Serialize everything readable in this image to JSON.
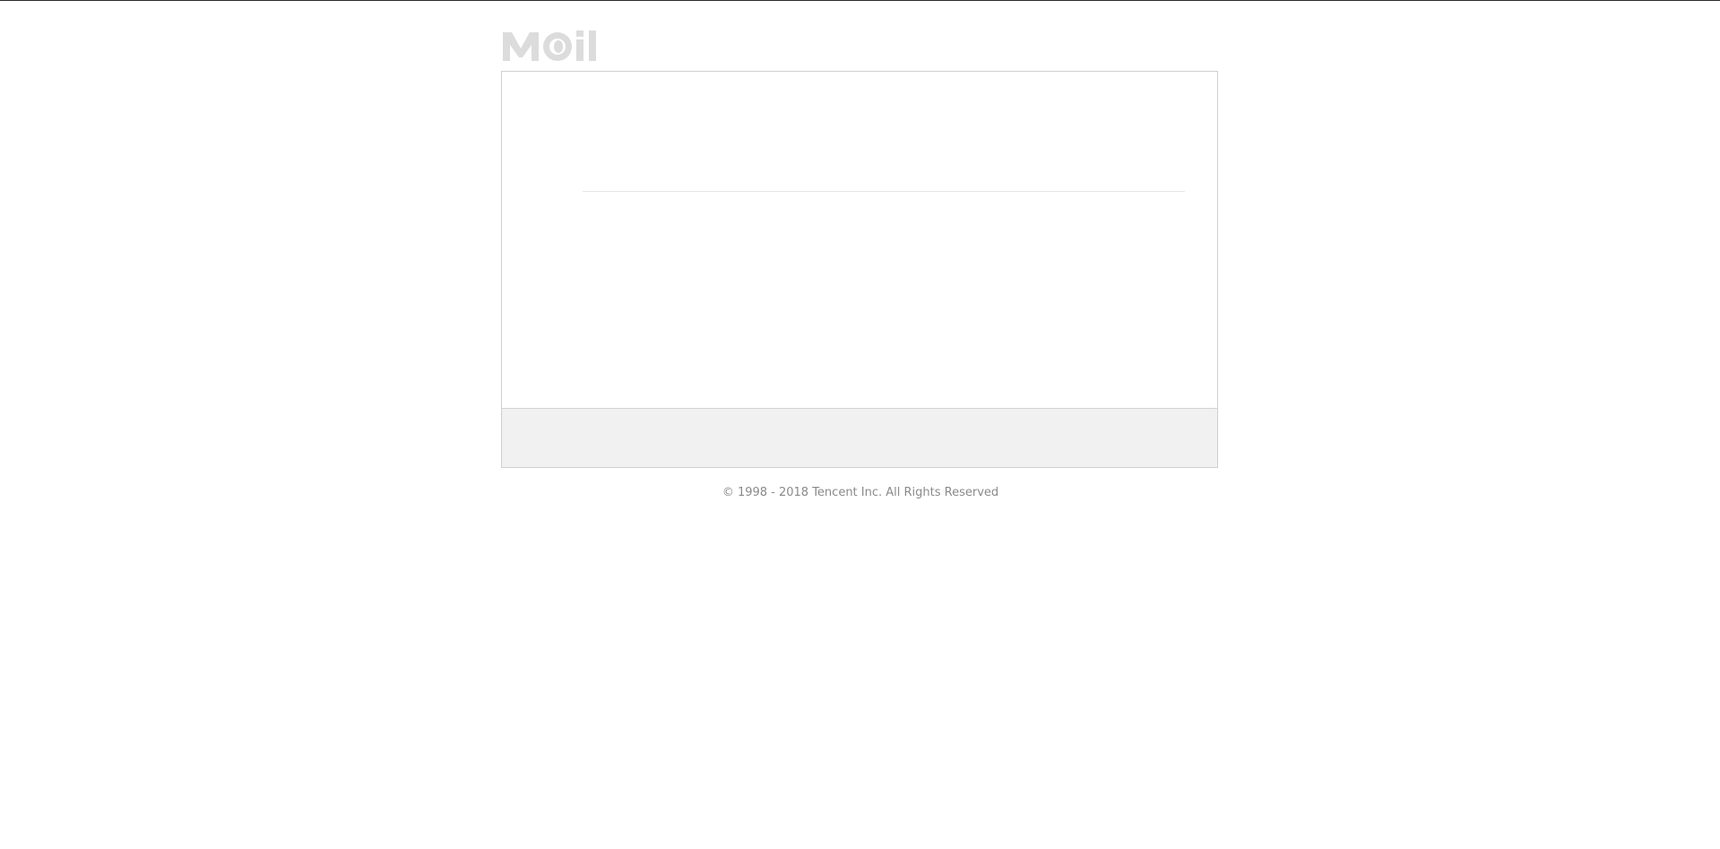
{
  "logo": {
    "text": "Mail",
    "icon": "mail-logo-icon",
    "color": "#dcdcdc"
  },
  "footer": {
    "copyright": "© 1998 - 2018 Tencent Inc. All Rights Reserved"
  },
  "colors": {
    "panel_border": "#cfcfcf",
    "panel_footer_bg": "#f1f1f1",
    "copyright_text": "#8a8a8a"
  }
}
